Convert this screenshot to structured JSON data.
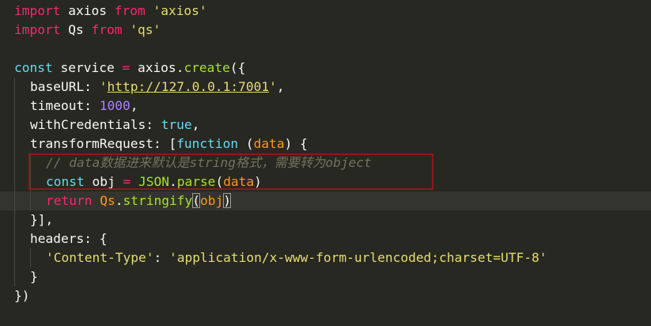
{
  "editor": {
    "theme_background": "#272822",
    "lines": {
      "l1": {
        "kw1": "import",
        "id1": " axios ",
        "kw2": "from",
        "sp": " ",
        "str1": "'axios'"
      },
      "l2": {
        "kw1": "import",
        "id1": " Qs ",
        "kw2": "from",
        "sp": " ",
        "str1": "'qs'"
      },
      "l4": {
        "kw1": "const",
        "id1": " service ",
        "op": "=",
        "id2": " axios",
        "dot": ".",
        "fn": "create",
        "pun": "({"
      },
      "l5": {
        "prop": "baseURL",
        "colon": ": ",
        "q1": "'",
        "url": "http://127.0.0.1:7001",
        "q2": "'",
        "end": ","
      },
      "l6": {
        "prop": "timeout",
        "colon": ": ",
        "num": "1000",
        "end": ","
      },
      "l7": {
        "prop": "withCredentials",
        "colon": ": ",
        "val": "true",
        "end": ","
      },
      "l8": {
        "prop": "transformRequest",
        "colon": ": ",
        "open": "[",
        "kw": "function",
        "sp": " (",
        "param": "data",
        "close": ") {"
      },
      "l9": {
        "comment": "// data数据进来默认是string格式，需要转为object"
      },
      "l10": {
        "kw": "const",
        "id": " obj ",
        "op": "=",
        "sp": " ",
        "obj": "JSON",
        "dot": ".",
        "fn": "parse",
        "open": "(",
        "param": "data",
        "close": ")"
      },
      "l11": {
        "kw": "return",
        "sp": " ",
        "obj": "Qs",
        "dot": ".",
        "fn": "stringify",
        "open": "(",
        "param": "obj",
        "close": ")"
      },
      "l12": {
        "text": "}],"
      },
      "l13": {
        "prop": "headers",
        "colon": ": ",
        "open": "{"
      },
      "l14": {
        "key": "'Content-Type'",
        "colon": ": ",
        "val": "'application/x-www-form-urlencoded;charset=UTF-8'"
      },
      "l15": {
        "text": "}"
      },
      "l16": {
        "text": "})"
      }
    }
  }
}
